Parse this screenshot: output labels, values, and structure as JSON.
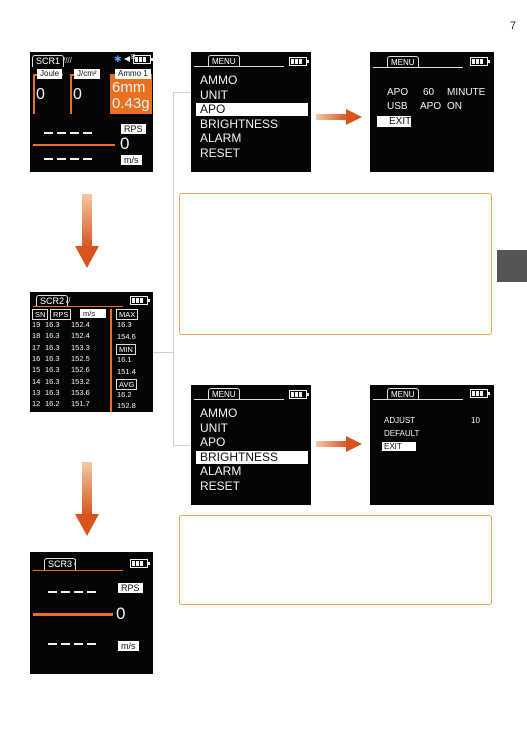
{
  "page_number": "7",
  "scr1": {
    "tab": "SCR1",
    "bluetooth_icon": "bluetooth-icon",
    "label_joule": "Joule",
    "label_jcm2": "J/cm²",
    "label_ammo": "Ammo 1",
    "val_joule": "0",
    "val_jcm2": "0",
    "ammo_size": "6mm",
    "ammo_weight": "0.43g",
    "rps_label": "RPS",
    "rps_value": "0",
    "unit_ms": "m/s"
  },
  "scr2": {
    "tab": "SCR2",
    "col_sn": "SN",
    "col_rps": "RPS",
    "col_ms": "m/s",
    "rows": [
      {
        "sn": "19",
        "rps": "16.3",
        "ms": "152.4"
      },
      {
        "sn": "18",
        "rps": "16.3",
        "ms": "152.4"
      },
      {
        "sn": "17",
        "rps": "16.3",
        "ms": "153.3"
      },
      {
        "sn": "16",
        "rps": "16.3",
        "ms": "152.5"
      },
      {
        "sn": "15",
        "rps": "16.3",
        "ms": "152.6"
      },
      {
        "sn": "14",
        "rps": "16.3",
        "ms": "153.2"
      },
      {
        "sn": "13",
        "rps": "16.3",
        "ms": "153.6"
      },
      {
        "sn": "12",
        "rps": "16.2",
        "ms": "151.7"
      }
    ],
    "max_label": "MAX",
    "max_rps": "16.3",
    "max_ms": "154.6",
    "min_label": "MIN",
    "min_rps": "16.1",
    "min_ms": "151.4",
    "avg_label": "AVG",
    "avg_rps": "16.2",
    "avg_ms": "152.8"
  },
  "scr3": {
    "tab": "SCR3",
    "rps_label": "RPS",
    "value": "0",
    "unit_ms": "m/s"
  },
  "menu1": {
    "tab": "MENU",
    "items": [
      "AMMO",
      "UNIT",
      "APO",
      "BRIGHTNESS",
      "ALARM",
      "RESET"
    ],
    "selected_index": 2
  },
  "apo_screen": {
    "tab": "MENU",
    "row1": [
      "APO",
      "60",
      "MINUTE"
    ],
    "row2": [
      "USB",
      "APO",
      "ON"
    ],
    "exit": "EXIT"
  },
  "menu2": {
    "tab": "MENU",
    "items": [
      "AMMO",
      "UNIT",
      "APO",
      "BRIGHTNESS",
      "ALARM",
      "RESET"
    ],
    "selected_index": 3
  },
  "brightness_screen": {
    "tab": "MENU",
    "adjust_label": "ADJUST",
    "adjust_value": "10",
    "default_label": "DEFAULT",
    "exit": "EXIT"
  },
  "colors": {
    "accent_orange": "#e8701f",
    "box_border": "#e8a25c",
    "screen_bg": "#050505"
  }
}
